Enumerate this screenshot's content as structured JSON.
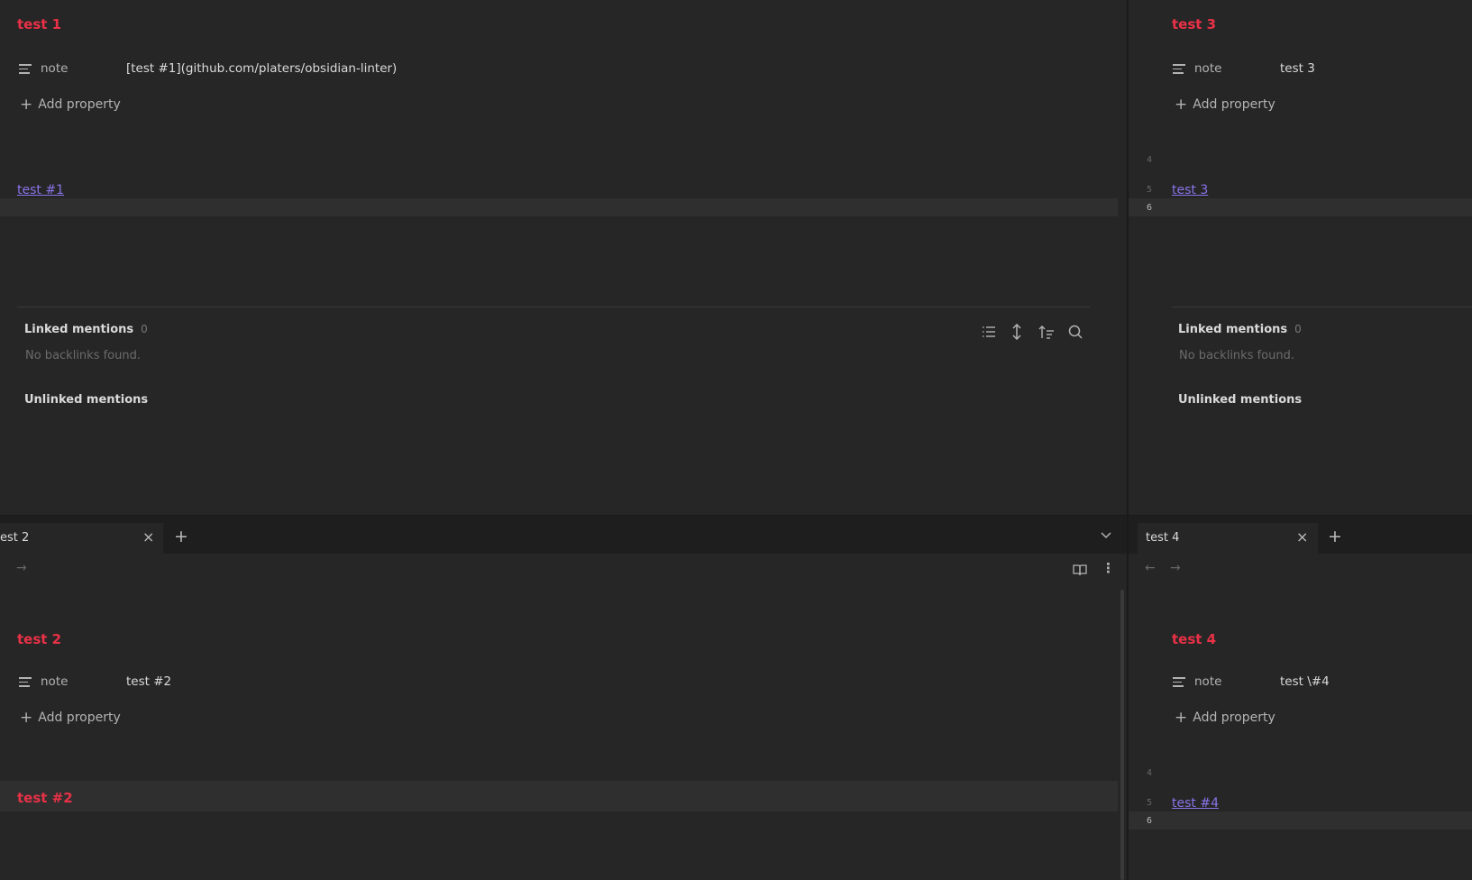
{
  "panes": {
    "top_left": {
      "title": "test 1",
      "property": {
        "key": "note",
        "value": "[test #1](github.com/platers/obsidian-linter)"
      },
      "add_property": "Add property",
      "body_link": "test #1"
    },
    "top_right": {
      "title": "test 3",
      "property": {
        "key": "note",
        "value": "test 3"
      },
      "add_property": "Add property",
      "line_numbers": [
        "4",
        "5",
        "6"
      ],
      "body_link": "test 3"
    },
    "bottom_left": {
      "tab": {
        "label": "est 2"
      },
      "title": "test 2",
      "property": {
        "key": "note",
        "value": "test #2"
      },
      "add_property": "Add property",
      "body_heading": "test #2"
    },
    "bottom_right": {
      "tab": {
        "label": "test 4"
      },
      "title": "test 4",
      "property": {
        "key": "note",
        "value": "test \\#4"
      },
      "add_property": "Add property",
      "line_numbers": [
        "4",
        "5",
        "6"
      ],
      "body_link": "test #4"
    }
  },
  "backlinks": {
    "linked_label": "Linked mentions",
    "linked_count": "0",
    "empty_text": "No backlinks found.",
    "unlinked_label": "Unlinked mentions"
  },
  "icons": {
    "close": "×",
    "plus": "+",
    "back": "←",
    "forward": "→",
    "chevron": "chevron-down-icon",
    "more": "⋮"
  },
  "colors": {
    "background": "#262626",
    "title": "#e93147",
    "link": "#8a73e8",
    "tabbar": "#1e1e1e"
  }
}
